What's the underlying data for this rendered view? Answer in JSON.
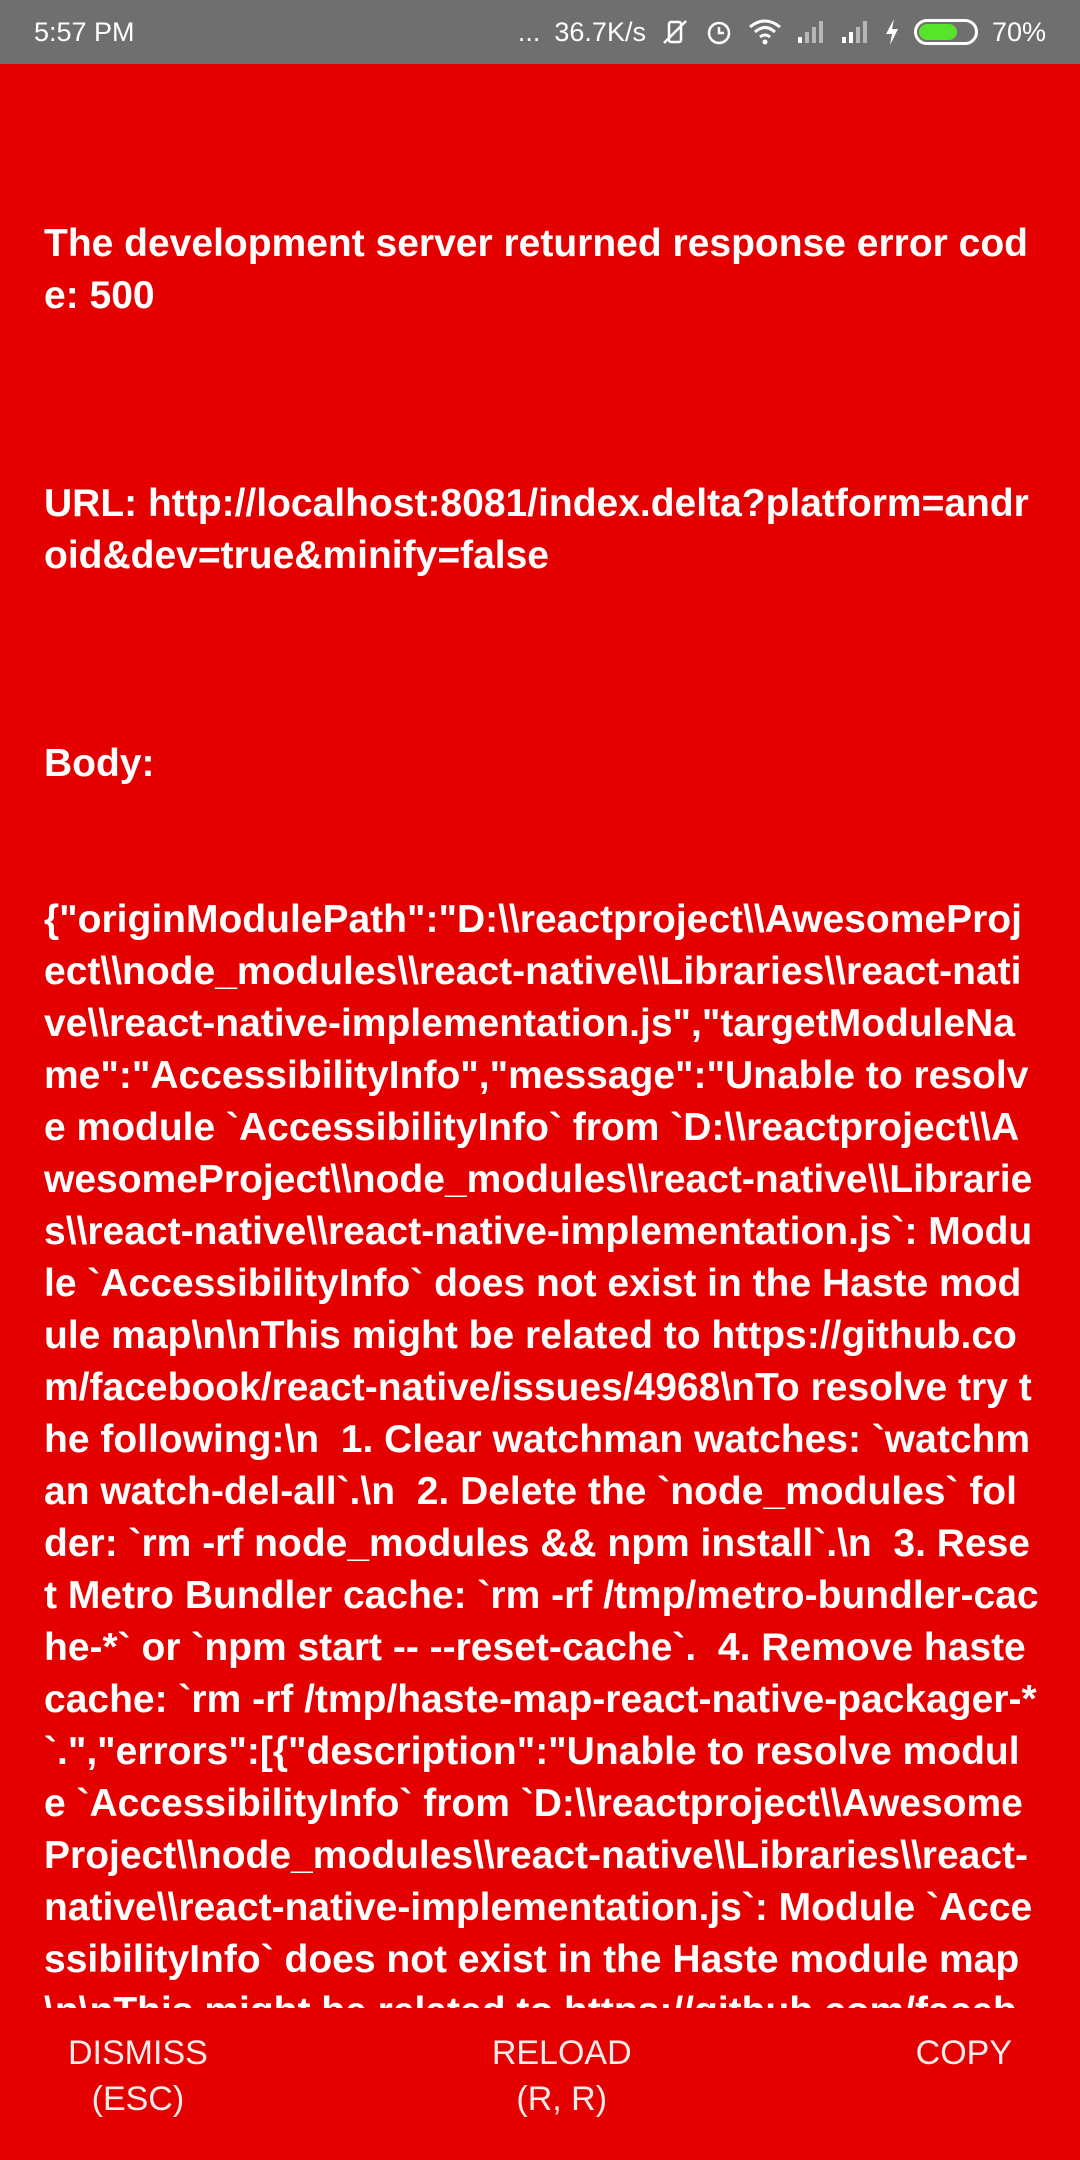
{
  "status_bar": {
    "time": "5:57 PM",
    "dots": "...",
    "net_speed": "36.7K/s",
    "battery_level_pct": 70,
    "battery_text": "70%"
  },
  "error": {
    "title": "The development server returned response error code: 500",
    "url": "URL: http://localhost:8081/index.delta?platform=android&dev=true&minify=false",
    "body_label": "Body:",
    "body_text": "{\"originModulePath\":\"D:\\\\reactproject\\\\AwesomeProject\\\\node_modules\\\\react-native\\\\Libraries\\\\react-native\\\\react-native-implementation.js\",\"targetModuleName\":\"AccessibilityInfo\",\"message\":\"Unable to resolve module `AccessibilityInfo` from `D:\\\\reactproject\\\\AwesomeProject\\\\node_modules\\\\react-native\\\\Libraries\\\\react-native\\\\react-native-implementation.js`: Module `AccessibilityInfo` does not exist in the Haste module map\\n\\nThis might be related to https://github.com/facebook/react-native/issues/4968\\nTo resolve try the following:\\n  1. Clear watchman watches: `watchman watch-del-all`.\\n  2. Delete the `node_modules` folder: `rm -rf node_modules && npm install`.\\n  3. Reset Metro Bundler cache: `rm -rf /tmp/metro-bundler-cache-*` or `npm start -- --reset-cache`.  4. Remove haste cache: `rm -rf /tmp/haste-map-react-native-packager-*`.\",\"errors\":[{\"description\":\"Unable to resolve module `AccessibilityInfo` from `D:\\\\reactproject\\\\AwesomeProject\\\\node_modules\\\\react-native\\\\Libraries\\\\react-native\\\\react-native-implementation.js`: Module `AccessibilityInfo` does not exist in the Haste module map\\n\\nThis might be related to https://github.com/facebook/react-native/issues/4968\\nTo resolve try the following:\\n  1. Clear watchman watches: `watchman watch-del-all`.\\n  2. Delete the `node_modules` folder: `rm -rf node_modules"
  },
  "buttons": {
    "dismiss": "DISMISS\n(ESC)",
    "reload": "RELOAD\n(R, R)",
    "copy": "COPY"
  },
  "colors": {
    "background": "#e50000",
    "status_bar": "#6f6f6f",
    "battery_fill": "#58e42b"
  },
  "icons": [
    "mute-vibrate-icon",
    "alarm-icon",
    "wifi-icon",
    "signal-icon",
    "signal-icon-2",
    "charging-icon",
    "battery-icon"
  ]
}
